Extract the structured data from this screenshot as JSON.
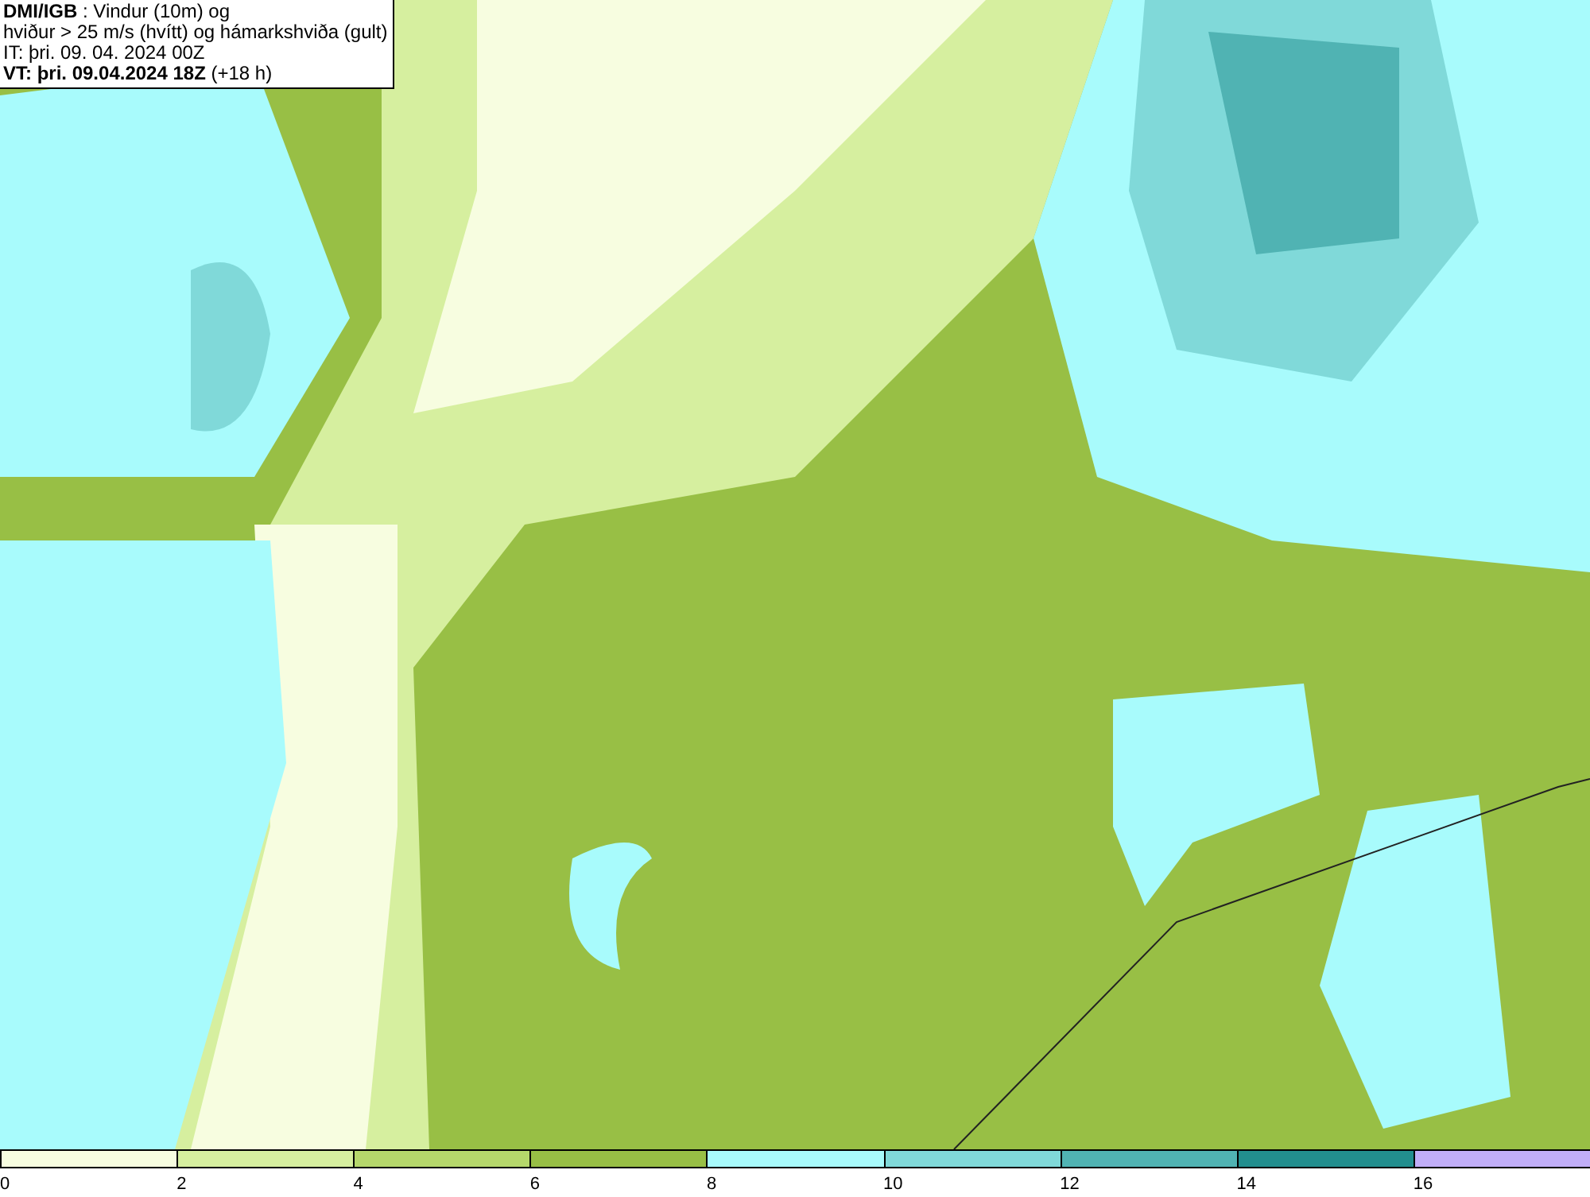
{
  "title_box": {
    "lines": [
      "**DMI/IGB** : Vindur (10m) og",
      "hviður > 25 m/s (hvítt) og hámarkshviða (gult)",
      "IT: þri. 09. 04. 2024 00Z",
      "**VT: þri. 09.04.2024 18Z** (+18 h)"
    ]
  },
  "legend": [
    {
      "label": "0",
      "color": "#f7fde0"
    },
    {
      "label": "2",
      "color": "#d6ef9f"
    },
    {
      "label": "4",
      "color": "#b5d76b"
    },
    {
      "label": "6",
      "color": "#98bf45"
    },
    {
      "label": "8",
      "color": "#a8fbfc"
    },
    {
      "label": "10",
      "color": "#80d9d9"
    },
    {
      "label": "12",
      "color": "#50b3b3"
    },
    {
      "label": "14",
      "color": "#228e8e"
    },
    {
      "label": "16",
      "color": "#c1aef8"
    }
  ]
}
